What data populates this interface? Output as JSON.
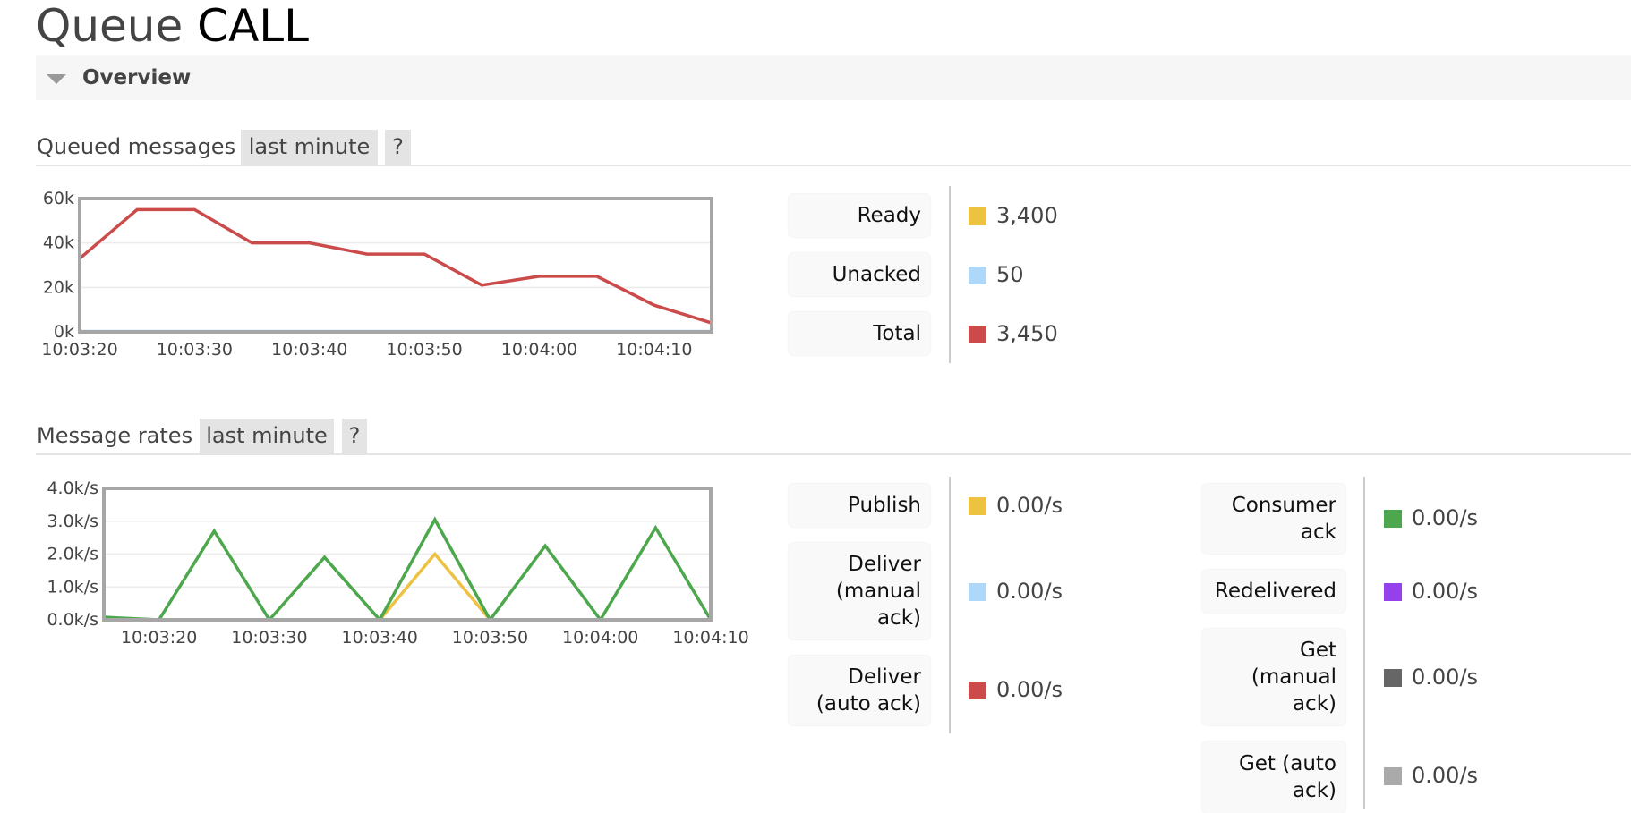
{
  "page": {
    "title_prefix": "Queue",
    "title_name": "CALL",
    "overview_label": "Overview"
  },
  "queued_section": {
    "heading": "Queued messages",
    "range_tag": "last minute",
    "help_tag": "?",
    "legend": [
      {
        "label": "Ready",
        "value": "3,400",
        "color": "#edc240"
      },
      {
        "label": "Unacked",
        "value": "50",
        "color": "#afd8f8"
      },
      {
        "label": "Total",
        "value": "3,450",
        "color": "#cb4b4b"
      }
    ]
  },
  "rates_section": {
    "heading": "Message rates",
    "range_tag": "last minute",
    "help_tag": "?",
    "legend_left": [
      {
        "label": "Publish",
        "value": "0.00/s",
        "color": "#edc240"
      },
      {
        "label": "Deliver (manual ack)",
        "value": "0.00/s",
        "color": "#afd8f8"
      },
      {
        "label": "Deliver (auto ack)",
        "value": "0.00/s",
        "color": "#cb4b4b"
      }
    ],
    "legend_right": [
      {
        "label": "Consumer ack",
        "value": "0.00/s",
        "color": "#4da74d"
      },
      {
        "label": "Redelivered",
        "value": "0.00/s",
        "color": "#9440ed"
      },
      {
        "label": "Get (manual ack)",
        "value": "0.00/s",
        "color": "#666666"
      },
      {
        "label": "Get (auto ack)",
        "value": "0.00/s",
        "color": "#aaaaaa"
      }
    ]
  },
  "chart_data": [
    {
      "type": "line",
      "title": "Queued messages",
      "xlabel": "",
      "ylabel": "",
      "x": [
        "10:03:20",
        "10:03:25",
        "10:03:30",
        "10:03:35",
        "10:03:40",
        "10:03:45",
        "10:03:50",
        "10:03:55",
        "10:04:00",
        "10:04:05",
        "10:04:10",
        "10:04:15"
      ],
      "x_seconds": [
        0,
        5,
        10,
        15,
        20,
        25,
        30,
        35,
        40,
        45,
        50,
        55
      ],
      "xlim_seconds": [
        0,
        55
      ],
      "x_ticks": [
        {
          "label": "10:03:20",
          "s": 0
        },
        {
          "label": "10:03:30",
          "s": 10
        },
        {
          "label": "10:03:40",
          "s": 20
        },
        {
          "label": "10:03:50",
          "s": 30
        },
        {
          "label": "10:04:00",
          "s": 40
        },
        {
          "label": "10:04:10",
          "s": 50
        }
      ],
      "ylim": [
        0,
        60000
      ],
      "y_ticks": [
        {
          "label": "0k",
          "v": 0
        },
        {
          "label": "20k",
          "v": 20000
        },
        {
          "label": "40k",
          "v": 40000
        },
        {
          "label": "60k",
          "v": 60000
        }
      ],
      "grid": true,
      "series": [
        {
          "name": "Unacked",
          "color": "#afd8f8",
          "values": [
            200,
            200,
            200,
            200,
            200,
            200,
            200,
            200,
            200,
            200,
            200,
            200
          ]
        },
        {
          "name": "Ready",
          "color": "#edc240",
          "values": [
            0,
            0,
            0,
            0,
            0,
            0,
            0,
            0,
            0,
            0,
            0,
            0
          ]
        },
        {
          "name": "Total",
          "color": "#cb4b4b",
          "values": [
            33000,
            55000,
            55000,
            40000,
            40000,
            35000,
            35000,
            21000,
            25000,
            25000,
            12000,
            4000
          ]
        }
      ]
    },
    {
      "type": "line",
      "title": "Message rates",
      "xlabel": "",
      "ylabel": "",
      "x": [
        "10:03:15",
        "10:03:20",
        "10:03:25",
        "10:03:30",
        "10:03:35",
        "10:03:40",
        "10:03:45",
        "10:03:50",
        "10:03:55",
        "10:04:00",
        "10:04:05",
        "10:04:10"
      ],
      "x_seconds": [
        0,
        5,
        10,
        15,
        20,
        25,
        30,
        35,
        40,
        45,
        50,
        55
      ],
      "xlim_seconds": [
        0,
        55
      ],
      "x_ticks": [
        {
          "label": "10:03:20",
          "s": 5
        },
        {
          "label": "10:03:30",
          "s": 15
        },
        {
          "label": "10:03:40",
          "s": 25
        },
        {
          "label": "10:03:50",
          "s": 35
        },
        {
          "label": "10:04:00",
          "s": 45
        },
        {
          "label": "10:04:10",
          "s": 55
        }
      ],
      "ylim": [
        0,
        4000
      ],
      "y_ticks": [
        {
          "label": "0.0k/s",
          "v": 0
        },
        {
          "label": "1.0k/s",
          "v": 1000
        },
        {
          "label": "2.0k/s",
          "v": 2000
        },
        {
          "label": "3.0k/s",
          "v": 3000
        },
        {
          "label": "4.0k/s",
          "v": 4000
        }
      ],
      "grid": true,
      "series": [
        {
          "name": "Publish",
          "color": "#edc240",
          "values": [
            0,
            0,
            0,
            0,
            0,
            0,
            2000,
            0,
            0,
            0,
            0,
            0
          ]
        },
        {
          "name": "Consumer ack",
          "color": "#4da74d",
          "values": [
            80,
            0,
            2700,
            0,
            1900,
            0,
            3050,
            0,
            2250,
            0,
            2800,
            0
          ]
        }
      ]
    }
  ]
}
